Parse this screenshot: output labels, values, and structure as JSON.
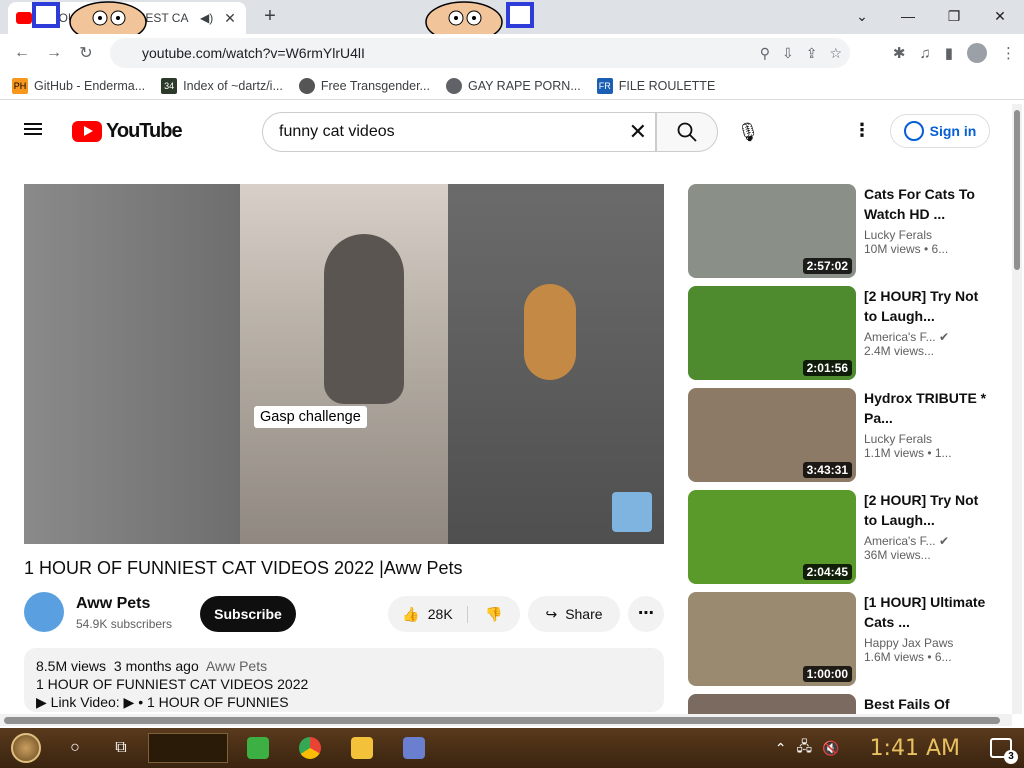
{
  "browser": {
    "tab_title": "1 HOUR OF FUNNIEST CA",
    "url": "youtube.com/watch?v=W6rmYlrU4lI",
    "bookmarks": [
      {
        "label": "GitHub - Enderma...",
        "icon_text": "PH",
        "icon_color": "#f7971e"
      },
      {
        "label": "Index of ~dartz/i...",
        "icon_text": "34",
        "icon_color": "#2b3a2b"
      },
      {
        "label": "Free Transgender...",
        "icon_text": "",
        "icon_color": "#555555"
      },
      {
        "label": "GAY RAPE PORN...",
        "icon_text": "",
        "icon_color": "#5f6368"
      },
      {
        "label": "FILE ROULETTE",
        "icon_text": "FR",
        "icon_color": "#1a5fb4"
      }
    ]
  },
  "youtube": {
    "logo_text": "YouTube",
    "search_value": "funny cat videos",
    "signin_label": "Sign in",
    "video": {
      "caption": "Gasp challenge",
      "title": "1 HOUR OF FUNNIEST CAT VIDEOS 2022 |Aww Pets",
      "channel": "Aww Pets",
      "subscribers": "54.9K subscribers",
      "subscribe_label": "Subscribe",
      "likes": "28K",
      "share_label": "Share",
      "views": "8.5M views",
      "age": "3 months ago",
      "desc_channel": "Aww Pets",
      "desc_line1": "1 HOUR OF FUNNIEST CAT VIDEOS 2022",
      "desc_line2": "▶ Link Video: ▶ • 1 HOUR OF FUNNIES"
    },
    "recommendations": [
      {
        "title": "Cats For Cats To Watch HD ...",
        "channel": "Lucky Ferals",
        "verified": false,
        "meta": "10M views • 6...",
        "duration": "2:57:02",
        "thumb_color": "#8a8f88"
      },
      {
        "title": "[2 HOUR] Try Not to Laugh...",
        "channel": "America's F...",
        "verified": true,
        "meta": "2.4M views...",
        "duration": "2:01:56",
        "thumb_color": "#4e8a2e"
      },
      {
        "title": "Hydrox TRIBUTE * Pa...",
        "channel": "Lucky Ferals",
        "verified": false,
        "meta": "1.1M views • 1...",
        "duration": "3:43:31",
        "thumb_color": "#8c7a66"
      },
      {
        "title": "[2 HOUR] Try Not to Laugh...",
        "channel": "America's F...",
        "verified": true,
        "meta": "36M views...",
        "duration": "2:04:45",
        "thumb_color": "#5a9a2a"
      },
      {
        "title": "[1 HOUR] Ultimate Cats ...",
        "channel": "Happy Jax Paws",
        "verified": false,
        "meta": "1.6M views • 6...",
        "duration": "1:00:00",
        "thumb_color": "#9a8a70"
      },
      {
        "title": "Best Fails Of",
        "channel": "",
        "verified": false,
        "meta": "",
        "duration": "",
        "thumb_color": "#7a6a60"
      }
    ]
  },
  "taskbar": {
    "clock": "1:41 AM",
    "notification_count": "3"
  }
}
